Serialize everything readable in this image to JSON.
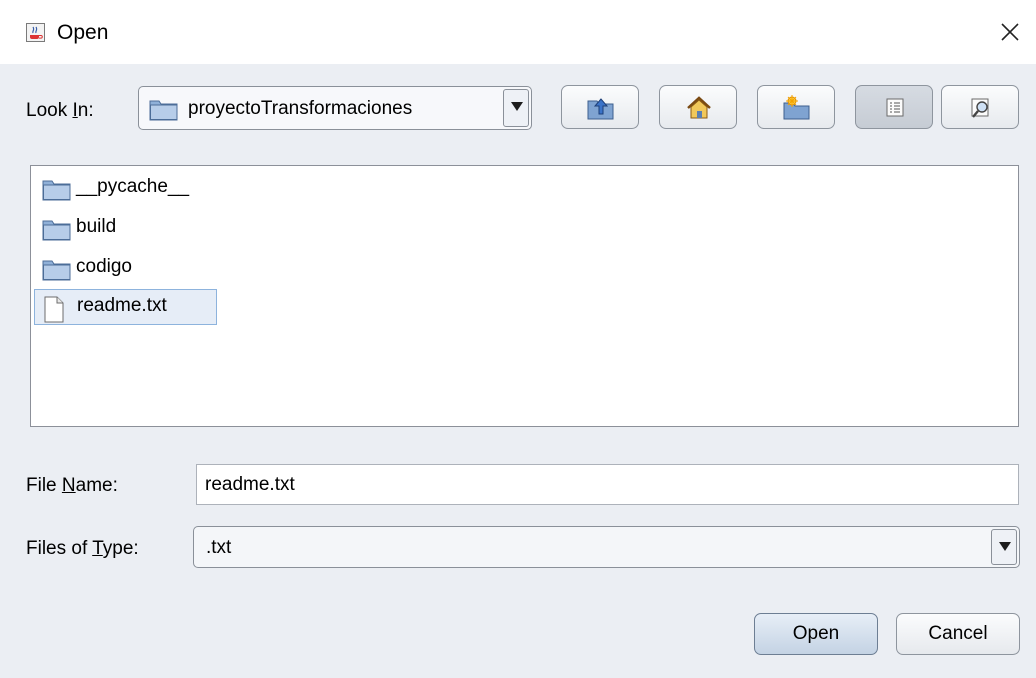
{
  "window": {
    "title": "Open",
    "app_icon": "java-coffee-cup-icon",
    "close_icon": "close-icon"
  },
  "look_in": {
    "label_before": "Look ",
    "label_mnemonic": "I",
    "label_after": "n:",
    "value": "proyectoTransformaciones",
    "icon": "folder-icon"
  },
  "toolbar": {
    "buttons": [
      {
        "name": "up-one-level",
        "icon": "folder-up-icon"
      },
      {
        "name": "home",
        "icon": "home-icon"
      },
      {
        "name": "new-folder",
        "icon": "new-folder-icon"
      },
      {
        "name": "list-view",
        "icon": "list-view-icon",
        "pressed": true
      },
      {
        "name": "details-view",
        "icon": "details-view-icon"
      }
    ]
  },
  "files": [
    {
      "name": "__pycache__",
      "type": "folder",
      "icon": "folder-icon"
    },
    {
      "name": "build",
      "type": "folder",
      "icon": "folder-icon"
    },
    {
      "name": "codigo",
      "type": "folder",
      "icon": "folder-icon"
    },
    {
      "name": "readme.txt",
      "type": "file",
      "icon": "file-icon",
      "selected": true
    }
  ],
  "file_name": {
    "label_before": "File ",
    "label_mnemonic": "N",
    "label_after": "ame:",
    "value": "readme.txt"
  },
  "files_of_type": {
    "label_before": "Files of ",
    "label_mnemonic": "T",
    "label_after": "ype:",
    "value": ".txt"
  },
  "buttons": {
    "open_label": "Open",
    "cancel_label": "Cancel"
  },
  "colors": {
    "dialog_bg": "#ebeef3",
    "selection_bg": "#e6edf7",
    "selection_border": "#8db3dd",
    "folder_blue": "#6f95c3"
  }
}
